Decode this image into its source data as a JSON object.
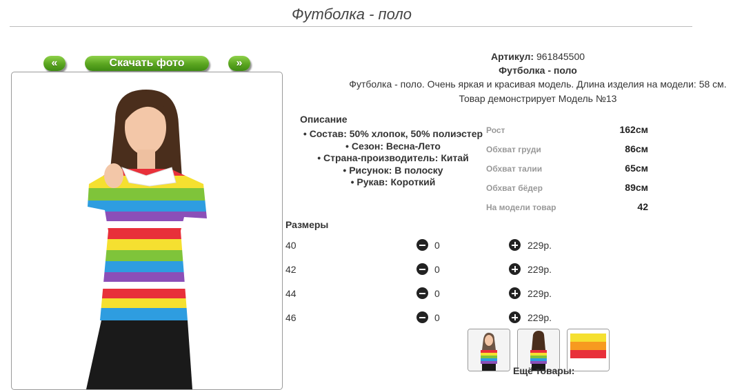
{
  "page": {
    "title": "Футболка - поло"
  },
  "gallery": {
    "prev_label": "«",
    "download_label": "Скачать фото",
    "next_label": "»"
  },
  "product": {
    "article_label": "Артикул:",
    "article_value": "961845500",
    "name": "Футболка - поло",
    "summary": "Футболка - поло. Очень яркая и красивая модель. Длина изделия на модели: 58 см.",
    "model_note": "Товар демонстрирует Модель №13"
  },
  "description": {
    "heading": "Описание",
    "items": [
      "Состав: 50% хлопок, 50% полиэстер",
      "Сезон: Весна-Лето",
      "Страна-производитель: Китай",
      "Рисунок: В полоску",
      "Рукав: Короткий"
    ]
  },
  "measurements": [
    {
      "label": "Рост",
      "value": "162см"
    },
    {
      "label": "Обхват груди",
      "value": "86см"
    },
    {
      "label": "Обхват талии",
      "value": "65см"
    },
    {
      "label": "Обхват бёдер",
      "value": "89см"
    },
    {
      "label": "На модели товар",
      "value": "42"
    }
  ],
  "sizes": {
    "heading": "Размеры",
    "rows": [
      {
        "size": "40",
        "qty": "0",
        "price": "229р."
      },
      {
        "size": "42",
        "qty": "0",
        "price": "229р."
      },
      {
        "size": "44",
        "qty": "0",
        "price": "229р."
      },
      {
        "size": "46",
        "qty": "0",
        "price": "229р."
      }
    ]
  },
  "more_label": "Ещё товары:",
  "colors": {
    "button_green": "#5aa520"
  }
}
